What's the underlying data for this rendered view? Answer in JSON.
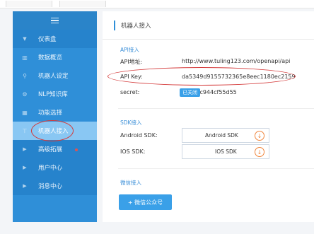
{
  "sidebar": {
    "items": [
      {
        "label": "仪表盘",
        "icon": "chevron-down-icon",
        "type": "group"
      },
      {
        "label": "数据概览",
        "icon": "bars-icon"
      },
      {
        "label": "机器人设定",
        "icon": "wrench-icon"
      },
      {
        "label": "NLP知识库",
        "icon": "gear-icon"
      },
      {
        "label": "功能选择",
        "icon": "grid-icon"
      },
      {
        "label": "机器人接入",
        "icon": "plug-icon",
        "active": true
      },
      {
        "label": "高级拓展",
        "icon": "caret-right-icon",
        "type": "group"
      },
      {
        "label": "用户中心",
        "icon": "caret-right-icon",
        "type": "group"
      },
      {
        "label": "消息中心",
        "icon": "caret-right-icon",
        "type": "group"
      }
    ]
  },
  "main": {
    "title": "机器人接入",
    "api": {
      "section_label": "API接入",
      "address_label": "API地址:",
      "address_value": "http://www.tuling123.com/openapi/api",
      "key_label": "API Key:",
      "key_value": "da5349d9155732365e8eec1180ec2159",
      "secret_label": "secret:",
      "secret_value": "74613c944cf55d55",
      "secret_status": "已关闭"
    },
    "sdk": {
      "section_label": "SDK接入",
      "android_label": "Android SDK:",
      "android_button": "Android SDK",
      "ios_label": "IOS SDK:",
      "ios_button": "IOS SDK"
    },
    "wechat": {
      "section_label": "微信接入",
      "button": "+ 微信公众号"
    }
  },
  "colors": {
    "sidebar": "#2f8fd8",
    "accent": "#3aa0e8",
    "annotation": "#d43a3a",
    "download": "#f0853c"
  }
}
